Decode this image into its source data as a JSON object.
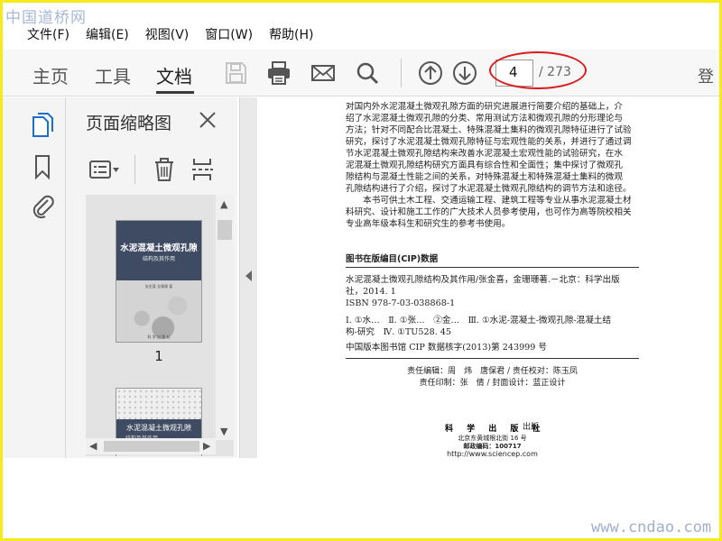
{
  "watermark": {
    "top_left": "中国道桥网",
    "bottom_right": "www.cndao.com"
  },
  "menu": [
    "文件(F)",
    "编辑(E)",
    "视图(V)",
    "窗口(W)",
    "帮助(H)"
  ],
  "toolbar": {
    "tabs": [
      "主页",
      "工具",
      "文档"
    ],
    "active_tab": "文档",
    "current_page": "4",
    "total_pages": "/ 273",
    "right_cut_char": "登",
    "icons": [
      "save-icon",
      "print-icon",
      "email-icon",
      "search-icon",
      "prev-page-icon",
      "next-page-icon"
    ]
  },
  "leftbar": {
    "icons": [
      "page-thumbnails-icon",
      "bookmark-icon",
      "attachment-icon"
    ]
  },
  "panel": {
    "title": "页面缩略图",
    "thumbnails": [
      {
        "number": "1",
        "cover_title": "水泥混凝土微观孔隙",
        "cover_subtitle": "结构及其作用",
        "cover_author": "张金喜 金珊珊 著",
        "cover_publisher": "科 学 出 版 社"
      },
      {
        "cover_title": "水泥混凝土微观孔隙",
        "cover_subtitle": "结构及其作用"
      }
    ]
  },
  "document": {
    "paragraph_lines": [
      "对国内外水泥混凝土微观孔隙方面的研究进展进行简要介绍的基础上，介",
      "绍了水泥混凝土微观孔隙的分类、常用测试方法和微观孔隙的分形理论与",
      "方法；针对不同配合比混凝土、特殊混凝土集料的微观孔隙特征进行了试验",
      "研究，探讨了水泥混凝土微观孔隙特征与宏观性能的关系，并进行了通过调",
      "节水泥混凝土微观孔隙结构来改善水泥混凝土宏观性能的试验研究，在水",
      "泥混凝土微观孔隙结构研究方面具有综合性和全面性；集中探讨了微观孔",
      "隙结构与混凝土性能之间的关系，对特殊混凝土和特殊混凝土集料的微观",
      "孔隙结构进行了介绍，探讨了水泥混凝土微观孔隙结构的调节方法和途径。",
      "　　本书可供土木工程、交通运输工程、建筑工程等专业从事水泥混凝土材",
      "料研究、设计和施工工作的广大技术人员参考使用，也可作为高等院校相关",
      "专业高年级本科生和研究生的参考书使用。"
    ],
    "cip_header": "图书在版编目(CIP)数据",
    "cip_lines": [
      "水泥混凝土微观孔隙结构及其作用/张金喜，金珊珊著.－北京：科学出版",
      "社，2014. 1",
      "ISBN 978-7-03-038868-1",
      "",
      "Ⅰ. ①水…　Ⅱ. ①张…　②金…　Ⅲ. ①水泥-混凝土-微观孔隙-混凝土结",
      "构-研究　Ⅳ. ①TU528. 45"
    ],
    "cip_library_line": "中国版本图书馆 CIP 数据核字(2013)第 243999 号",
    "credits": [
      "责任编辑：周　炜　唐保君 / 责任校对：陈玉凤",
      "责任印制：张　倩 / 封面设计：蓝正设计"
    ],
    "publisher_name": "科 学 出 版 社",
    "publisher_suffix": "出版",
    "publisher_address": "北京东黄城根北街 16 号",
    "postal_code": "邮政编码：100717",
    "website": "http://www.sciencep.com"
  }
}
